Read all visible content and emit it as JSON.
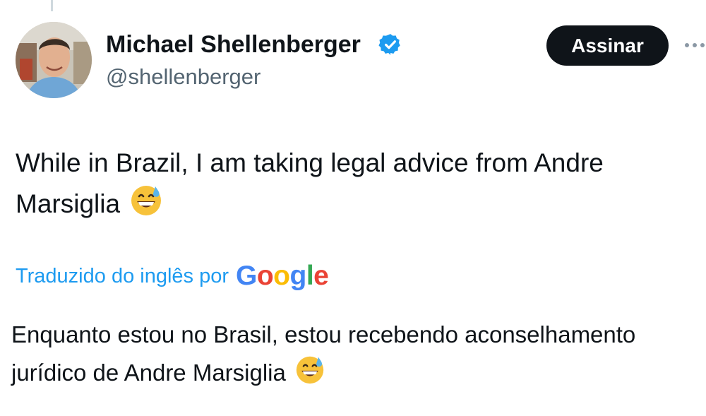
{
  "author": {
    "name": "Michael Shellenberger",
    "handle": "@shellenberger",
    "verified_color": "#1d9bf0"
  },
  "actions": {
    "subscribe_label": "Assinar",
    "more_icon": "more-horizontal-icon"
  },
  "tweet": {
    "text_line1": "While in Brazil, I am taking legal advice from Andre",
    "text_line2": "Marsiglia",
    "emoji": "grinning-face-with-sweat"
  },
  "translation": {
    "label": "Traduzido do inglês por",
    "provider": "Google",
    "text_line1": "Enquanto estou no Brasil, estou recebendo aconselhamento",
    "text_line2": "jurídico de Andre Marsiglia"
  },
  "colors": {
    "text": "#0f1419",
    "secondary": "#536471",
    "accent": "#1d9bf0",
    "button": "#0f1419"
  }
}
